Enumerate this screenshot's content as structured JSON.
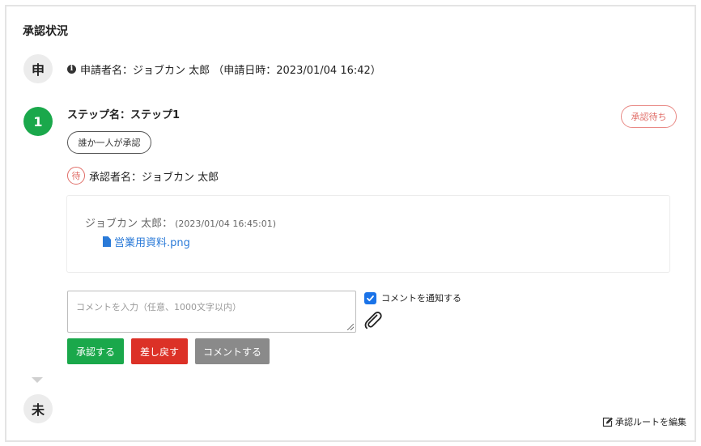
{
  "header": {
    "title": "承認状況"
  },
  "applicant": {
    "badge": "申",
    "text": "申請者名：ジョブカン 太郎 （申請日時：2023/01/04 16:42）"
  },
  "step": {
    "number": "1",
    "name": "ステップ名：ステップ1",
    "status": "承認待ち",
    "rule": "誰か一人が承認",
    "wait_badge": "待",
    "approver": "承認者名：ジョブカン 太郎"
  },
  "comment": {
    "author": "ジョブカン 太郎：",
    "date": "(2023/01/04 16:45:01)",
    "file_name": "営業用資料.png"
  },
  "form": {
    "placeholder": "コメントを入力（任意、1000文字以内）",
    "notify_label": "コメントを通知する",
    "notify_checked": true,
    "approve_label": "承認する",
    "return_label": "差し戻す",
    "comment_label": "コメントする"
  },
  "pending": {
    "badge": "未"
  },
  "footer": {
    "edit_route_label": "承認ルートを編集"
  },
  "colors": {
    "green": "#1aa84b",
    "red": "#dc3127",
    "grey": "#8a8a8a",
    "status_pink": "#e06d67",
    "link_blue": "#2a7ad8",
    "checkbox_blue": "#1a73e8"
  },
  "icons": [
    "info-icon",
    "file-icon",
    "paperclip-icon",
    "check-icon",
    "chevron-down-icon",
    "edit-icon"
  ]
}
